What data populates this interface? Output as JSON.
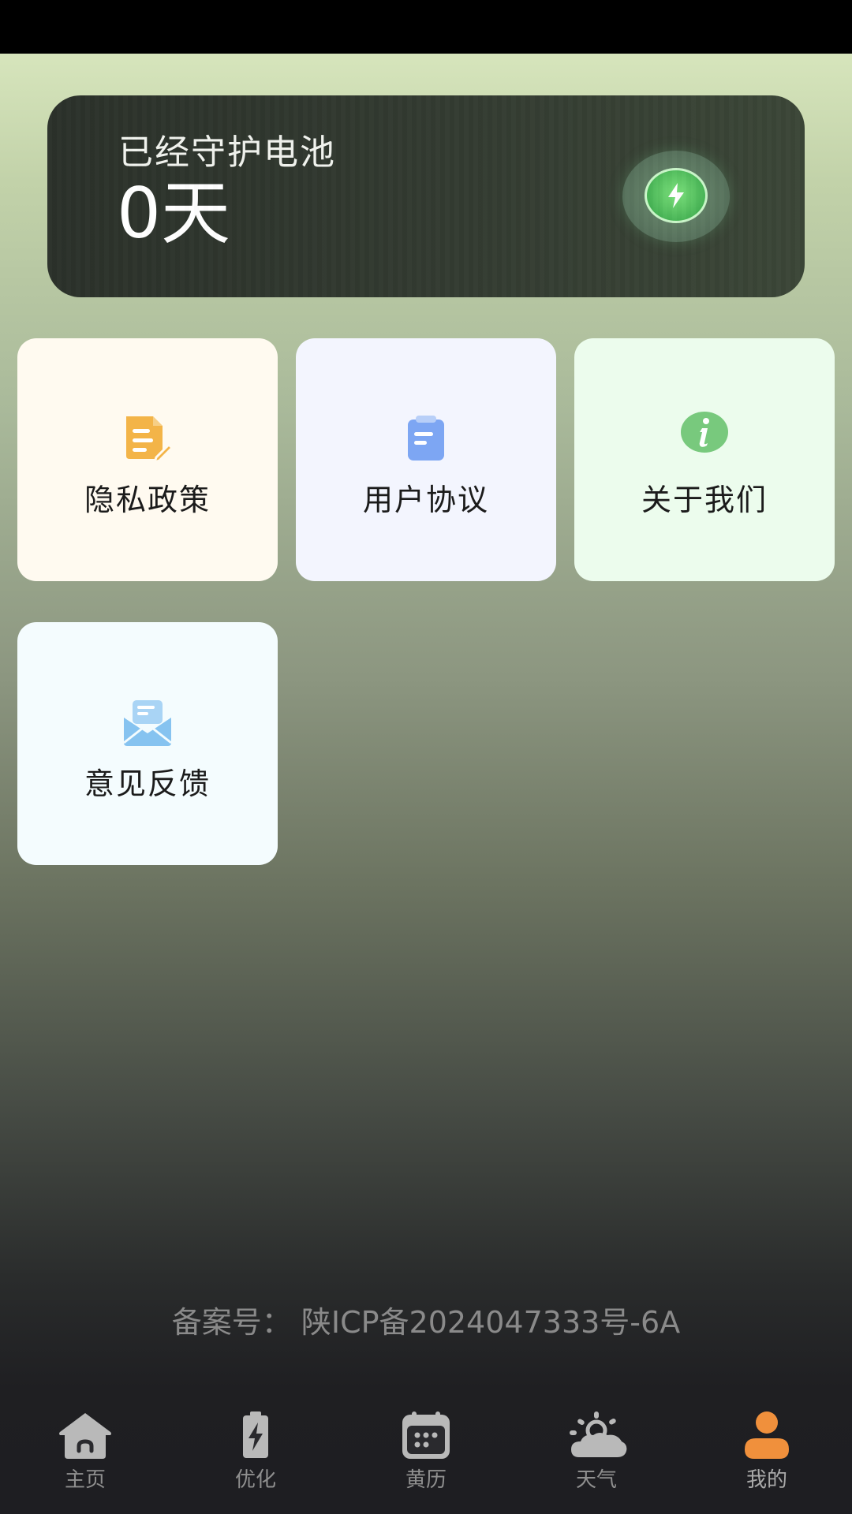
{
  "guard_card": {
    "title": "已经守护电池",
    "days": "0天"
  },
  "menu": [
    {
      "label": "隐私政策",
      "icon": "document-edit-icon"
    },
    {
      "label": "用户协议",
      "icon": "clipboard-icon"
    },
    {
      "label": "关于我们",
      "icon": "info-icon"
    },
    {
      "label": "意见反馈",
      "icon": "mail-icon"
    }
  ],
  "icp": "备案号：  陕ICP备2024047333号-6A",
  "nav": [
    {
      "label": "主页",
      "icon": "home-icon"
    },
    {
      "label": "优化",
      "icon": "battery-bolt-icon"
    },
    {
      "label": "黄历",
      "icon": "calendar-icon"
    },
    {
      "label": "天气",
      "icon": "weather-icon"
    },
    {
      "label": "我的",
      "icon": "user-icon",
      "active": true
    }
  ],
  "colors": {
    "accent": "#f0903c",
    "nav_icon": "#b9b9b9",
    "privacy_icon": "#f3b448",
    "agreement_icon": "#7da6f3",
    "about_icon": "#78c97d",
    "feedback_icon": "#86c3f0"
  }
}
